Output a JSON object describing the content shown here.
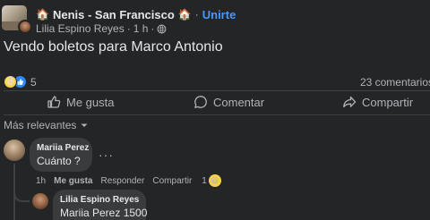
{
  "header": {
    "group_name": "Nenis - San Francisco",
    "emoji_left": "🏠",
    "emoji_right": "🏠",
    "separator": "·",
    "join_label": "Unirte",
    "poster_name": "Lilia Espino Reyes",
    "time": "1 h",
    "visibility_icon": "globe-icon"
  },
  "post": {
    "text": "Vendo boletos para Marco Antonio"
  },
  "stats": {
    "reactions_count": "5",
    "reaction_types": [
      "haha",
      "like"
    ],
    "comments_label": "23 comentarios"
  },
  "actions": {
    "like_label": "Me gusta",
    "comment_label": "Comentar",
    "share_label": "Compartir"
  },
  "sort": {
    "label": "Más relevantes"
  },
  "comments": [
    {
      "author": "Mariia Perez",
      "text": "Cuánto ?",
      "more": "···",
      "time": "1h",
      "like_label": "Me gusta",
      "reply_label": "Responder",
      "share_label": "Compartir",
      "reaction_count": "1",
      "reaction_type": "haha"
    }
  ],
  "replies": [
    {
      "author": "Lilia Espino Reyes",
      "text": "Mariia Perez 1500"
    }
  ],
  "colors": {
    "background": "#242526",
    "bubble": "#3a3b3c",
    "link": "#4599ff",
    "muted_text": "#b0b3b8"
  }
}
